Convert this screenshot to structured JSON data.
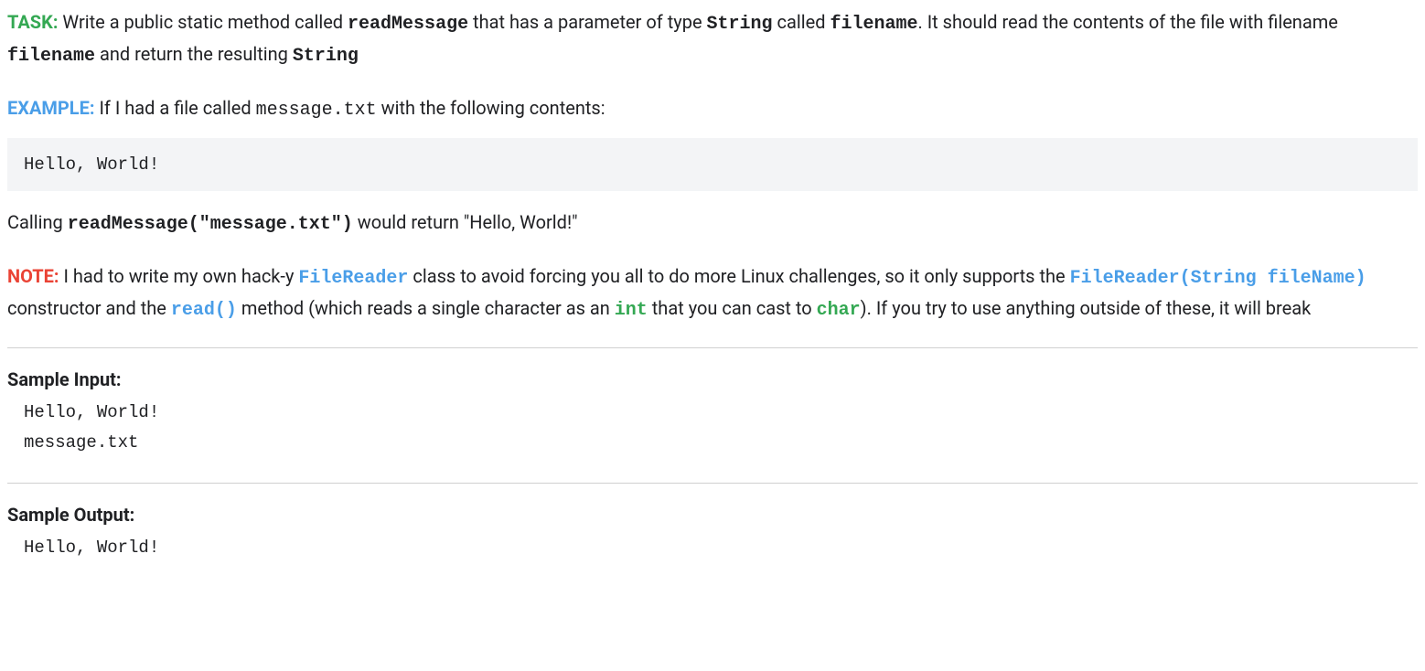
{
  "task": {
    "label": "TASK:",
    "text_1": " Write a public static method called ",
    "code_1": "readMessage",
    "text_2": " that has a parameter of type ",
    "code_2": "String",
    "text_3": " called ",
    "code_3": "filename",
    "text_4": ". It should read the contents of the file with filename ",
    "code_4": "filename",
    "text_5": " and return the resulting ",
    "code_5": "String"
  },
  "example": {
    "label": "EXAMPLE:",
    "text_1": " If I had a file called ",
    "code_1": "message.txt",
    "text_2": " with the following contents:",
    "file_contents": "Hello, World!",
    "text_3": "Calling ",
    "code_2": "readMessage(\"message.txt\")",
    "text_4": " would return \"Hello, World!\""
  },
  "note": {
    "label": "NOTE:",
    "text_1": " I had to write my own hack-y ",
    "code_1": "FileReader",
    "text_2": " class to avoid forcing you all to do more Linux challenges, so it only supports the ",
    "code_2": "FileReader(String fileName)",
    "text_3": " constructor and the ",
    "code_3": "read()",
    "text_4": " method (which reads a single character as an ",
    "code_4": "int",
    "text_5": " that you can cast to ",
    "code_5": "char",
    "text_6": "). If you try to use anything outside of these, it will break"
  },
  "sample_input": {
    "header": "Sample Input:",
    "content": "Hello, World!\nmessage.txt"
  },
  "sample_output": {
    "header": "Sample Output:",
    "content": "Hello, World!"
  }
}
